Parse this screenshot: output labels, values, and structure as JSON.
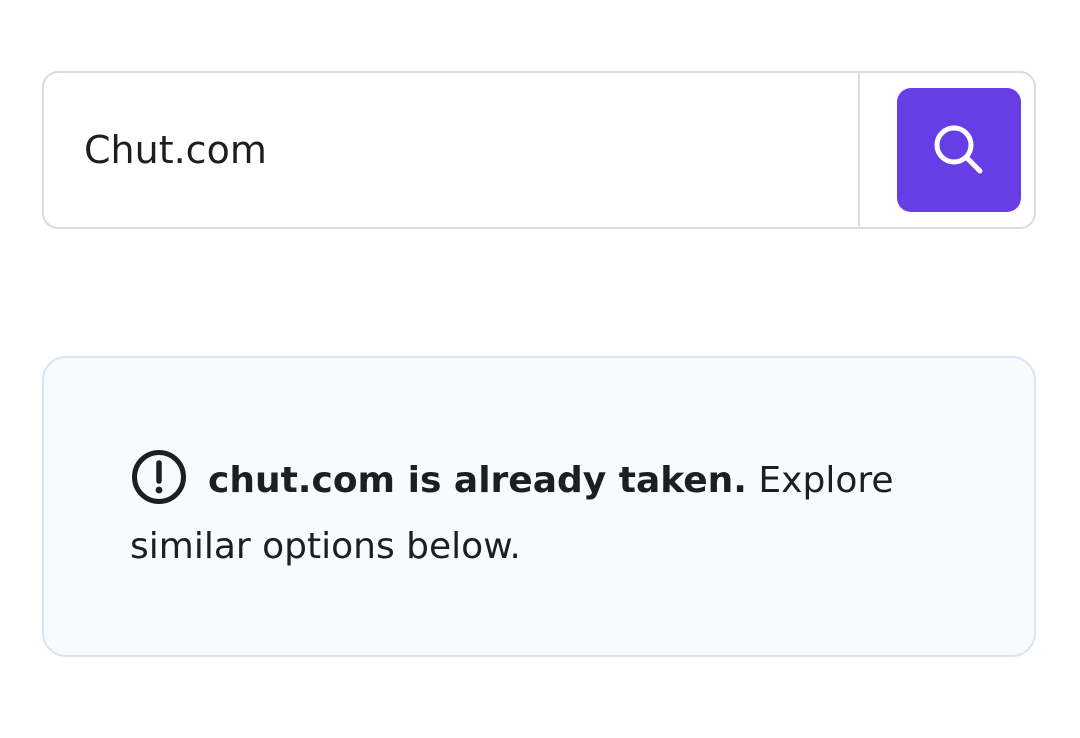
{
  "search": {
    "value": "Chut.com",
    "button_icon": "search-icon",
    "accent_color": "#673de6"
  },
  "notice": {
    "icon": "alert-circle-icon",
    "strong_text": "chut.com is already taken.",
    "rest_text": "Explore similar options below."
  }
}
